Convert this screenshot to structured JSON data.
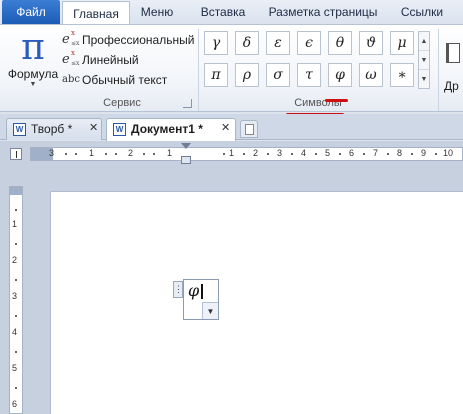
{
  "ribbon_tabs": [
    "Файл",
    "Главная",
    "Меню",
    "Вставка",
    "Разметка страницы",
    "Ссылки"
  ],
  "formula": {
    "glyph": "π",
    "label": "Формула"
  },
  "service": {
    "items": [
      {
        "label": "Профессиональный",
        "icon": "professional-format-icon"
      },
      {
        "label": "Линейный",
        "icon": "linear-format-icon"
      },
      {
        "label": "Обычный текст",
        "icon": "normal-text-icon",
        "abc": "abc"
      }
    ],
    "group_label": "Сервис"
  },
  "symbols": {
    "row1": [
      "γ",
      "δ",
      "ε",
      "ϵ",
      "θ",
      "ϑ",
      "μ"
    ],
    "row2": [
      "π",
      "ρ",
      "σ",
      "τ",
      "φ",
      "ω",
      "∗"
    ],
    "group_label": "Символы",
    "highlight_color": "#d01010"
  },
  "right_fragment_label": "Др",
  "doc_tabs": [
    {
      "label": "Творб *",
      "active": false
    },
    {
      "label": "Документ1 *",
      "active": true
    }
  ],
  "ruler": {
    "h_numbers": [
      "3",
      "1",
      "2",
      "1",
      "1",
      "2",
      "3",
      "4",
      "5",
      "6",
      "7",
      "8",
      "9",
      "10"
    ],
    "v_numbers": [
      "1",
      "2",
      "3",
      "4",
      "5",
      "6"
    ]
  },
  "equation": {
    "content": "φ",
    "handle": "⋮"
  },
  "colors": {
    "file_tab": "#2b6cc9",
    "accent": "#2a5bbd"
  }
}
